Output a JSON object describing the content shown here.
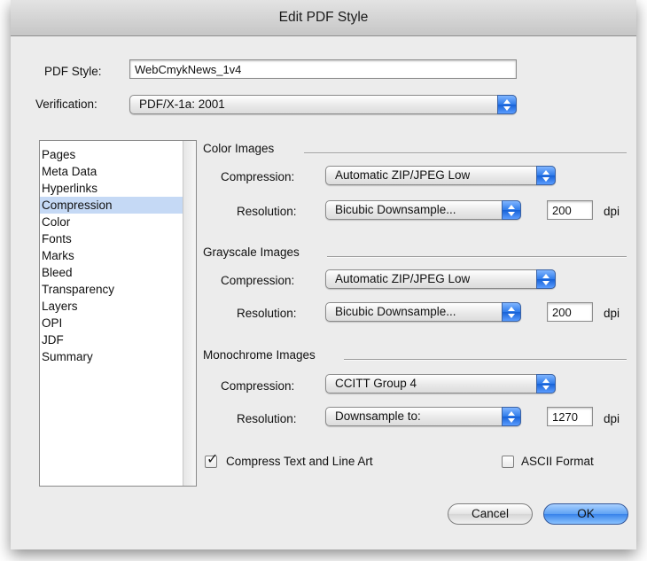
{
  "window": {
    "title": "Edit PDF Style"
  },
  "pdf_style": {
    "label": "PDF Style:",
    "value": "WebCmykNews_1v4"
  },
  "verification": {
    "label": "Verification:",
    "value": "PDF/X-1a: 2001"
  },
  "sidebar": {
    "items": [
      {
        "label": "Pages"
      },
      {
        "label": "Meta Data"
      },
      {
        "label": "Hyperlinks"
      },
      {
        "label": "Compression",
        "selected": true
      },
      {
        "label": "Color"
      },
      {
        "label": "Fonts"
      },
      {
        "label": "Marks"
      },
      {
        "label": "Bleed"
      },
      {
        "label": "Transparency"
      },
      {
        "label": "Layers"
      },
      {
        "label": "OPI"
      },
      {
        "label": "JDF"
      },
      {
        "label": "Summary"
      }
    ]
  },
  "sections": {
    "color": {
      "title": "Color Images",
      "compression_label": "Compression:",
      "compression_value": "Automatic ZIP/JPEG Low",
      "resolution_label": "Resolution:",
      "resolution_value": "Bicubic Downsample...",
      "dpi_value": "200",
      "dpi_unit": "dpi"
    },
    "grayscale": {
      "title": "Grayscale Images",
      "compression_label": "Compression:",
      "compression_value": "Automatic ZIP/JPEG Low",
      "resolution_label": "Resolution:",
      "resolution_value": "Bicubic Downsample...",
      "dpi_value": "200",
      "dpi_unit": "dpi"
    },
    "monochrome": {
      "title": "Monochrome Images",
      "compression_label": "Compression:",
      "compression_value": "CCITT Group 4",
      "resolution_label": "Resolution:",
      "resolution_value": "Downsample to:",
      "dpi_value": "1270",
      "dpi_unit": "dpi"
    }
  },
  "options": {
    "compress_text": {
      "label": "Compress Text and Line Art",
      "checked": true
    },
    "ascii_format": {
      "label": "ASCII Format",
      "checked": false
    }
  },
  "buttons": {
    "cancel": "Cancel",
    "ok": "OK"
  },
  "colors": {
    "selection": "#c5d9f5",
    "accent": "#3883ea",
    "window_bg": "#ececec"
  }
}
